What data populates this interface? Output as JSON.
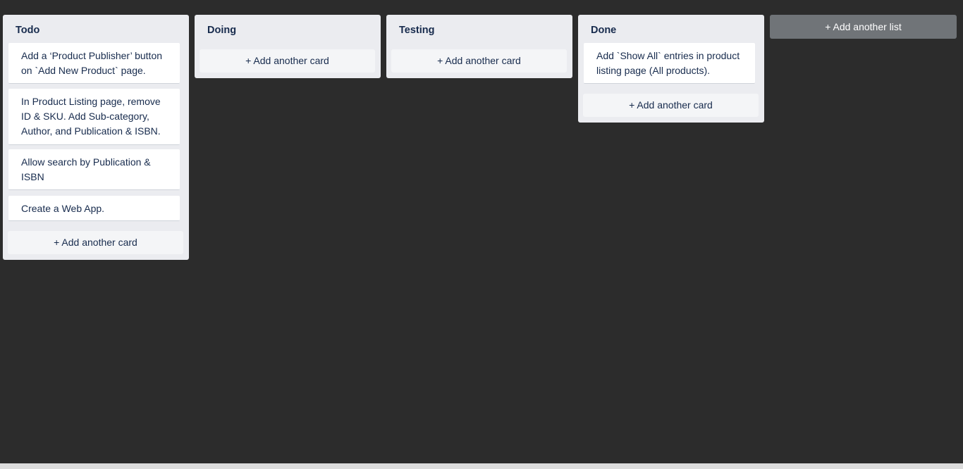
{
  "lists": [
    {
      "title": "Todo",
      "cards": [
        "Add a ‘Product Publisher’ button on `Add New Product` page.",
        "In Product Listing page, remove ID & SKU. Add Sub-category, Author, and Publication & ISBN.",
        "Allow search by Publication & ISBN",
        "Create a Web App."
      ],
      "add_card_label": "+ Add another card"
    },
    {
      "title": "Doing",
      "cards": [],
      "add_card_label": "+ Add another card"
    },
    {
      "title": "Testing",
      "cards": [],
      "add_card_label": "+ Add another card"
    },
    {
      "title": "Done",
      "cards": [
        "Add `Show All` entries in product listing page (All products)."
      ],
      "add_card_label": "+ Add another card"
    }
  ],
  "add_list_label": "+ Add another list",
  "colors": {
    "board_background": "#2c2c2c",
    "list_background": "#ebecf0",
    "card_background": "#ffffff",
    "add_list_background": "#707478"
  }
}
